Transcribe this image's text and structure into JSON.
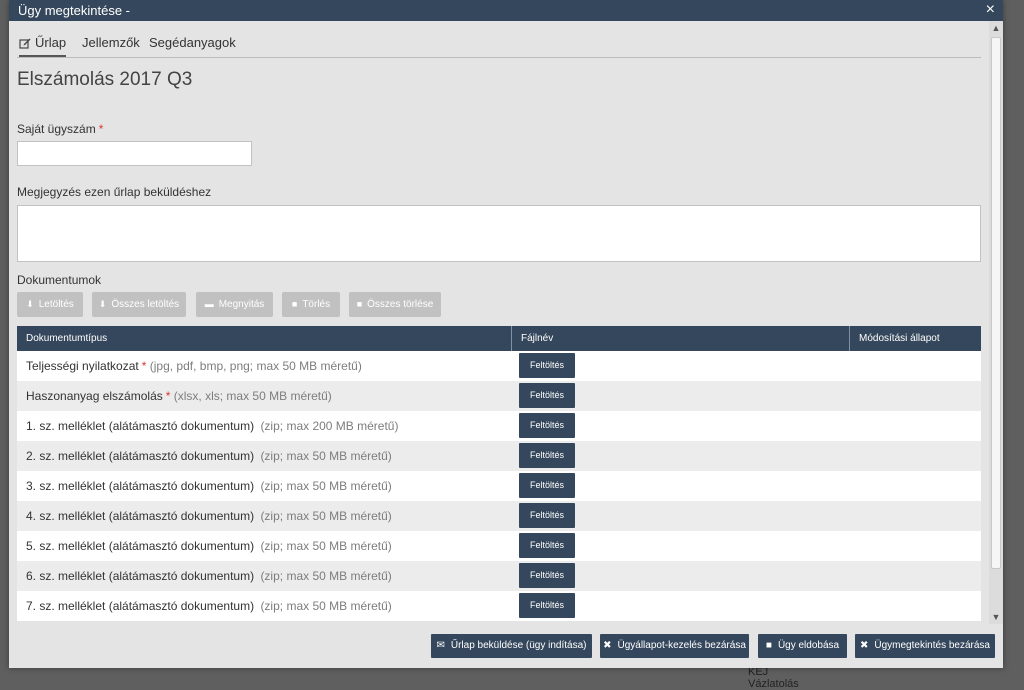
{
  "modal": {
    "title": "Ügy megtekintése -",
    "close_glyph": "×"
  },
  "tabs": [
    {
      "label": "Űrlap",
      "active": true,
      "icon": "edit-icon"
    },
    {
      "label": "Jellemzők",
      "active": false
    },
    {
      "label": "Segédanyagok",
      "active": false
    }
  ],
  "page_title": "Elszámolás 2017 Q3",
  "form": {
    "case_number_label": "Saját ügyszám",
    "case_number_value": "",
    "required_mark": "*",
    "note_label": "Megjegyzés ezen űrlap beküldéshez",
    "note_value": ""
  },
  "documents": {
    "section_label": "Dokumentumok",
    "toolbar": {
      "download": "Letöltés",
      "download_all": "Összes letöltés",
      "open": "Megnyitás",
      "delete": "Törlés",
      "delete_all": "Összes törlése"
    },
    "columns": [
      "Dokumentumtípus",
      "Fájlnév",
      "Módosítási állapot"
    ],
    "upload_label": "Feltöltés",
    "rows": [
      {
        "type": "Teljességi nyilatkozat",
        "required": "*",
        "hint": "(jpg, pdf, bmp, png; max 50 MB méretű)",
        "filename": "",
        "status": ""
      },
      {
        "type": "Haszonanyag elszámolás",
        "required": "*",
        "hint": "(xlsx, xls; max 50 MB méretű)",
        "filename": "",
        "status": ""
      },
      {
        "type": "1. sz. melléklet (alátámasztó dokumentum)",
        "required": "",
        "hint": "(zip; max 200 MB méretű)",
        "filename": "",
        "status": ""
      },
      {
        "type": "2. sz. melléklet (alátámasztó dokumentum)",
        "required": "",
        "hint": "(zip; max 50 MB méretű)",
        "filename": "",
        "status": ""
      },
      {
        "type": "3. sz. melléklet (alátámasztó dokumentum)",
        "required": "",
        "hint": "(zip; max 50 MB méretű)",
        "filename": "",
        "status": ""
      },
      {
        "type": "4. sz. melléklet (alátámasztó dokumentum)",
        "required": "",
        "hint": "(zip; max 50 MB méretű)",
        "filename": "",
        "status": ""
      },
      {
        "type": "5. sz. melléklet (alátámasztó dokumentum)",
        "required": "",
        "hint": "(zip; max 50 MB méretű)",
        "filename": "",
        "status": ""
      },
      {
        "type": "6. sz. melléklet (alátámasztó dokumentum)",
        "required": "",
        "hint": "(zip; max 50 MB méretű)",
        "filename": "",
        "status": ""
      },
      {
        "type": "7. sz. melléklet (alátámasztó dokumentum)",
        "required": "",
        "hint": "(zip; max 50 MB méretű)",
        "filename": "",
        "status": ""
      }
    ]
  },
  "footer": {
    "submit": "Űrlap beküldése (ügy indítása)",
    "close_status": "Ügyállapot-kezelés bezárása",
    "discard": "Ügy eldobása",
    "close_view": "Ügymegtekintés bezárása"
  },
  "background_text": [
    "KEJ",
    "Vázlatolás"
  ],
  "colors": {
    "header_bg": "#35475c",
    "required": "#d9372f",
    "light_button": "#c1c1c1"
  }
}
